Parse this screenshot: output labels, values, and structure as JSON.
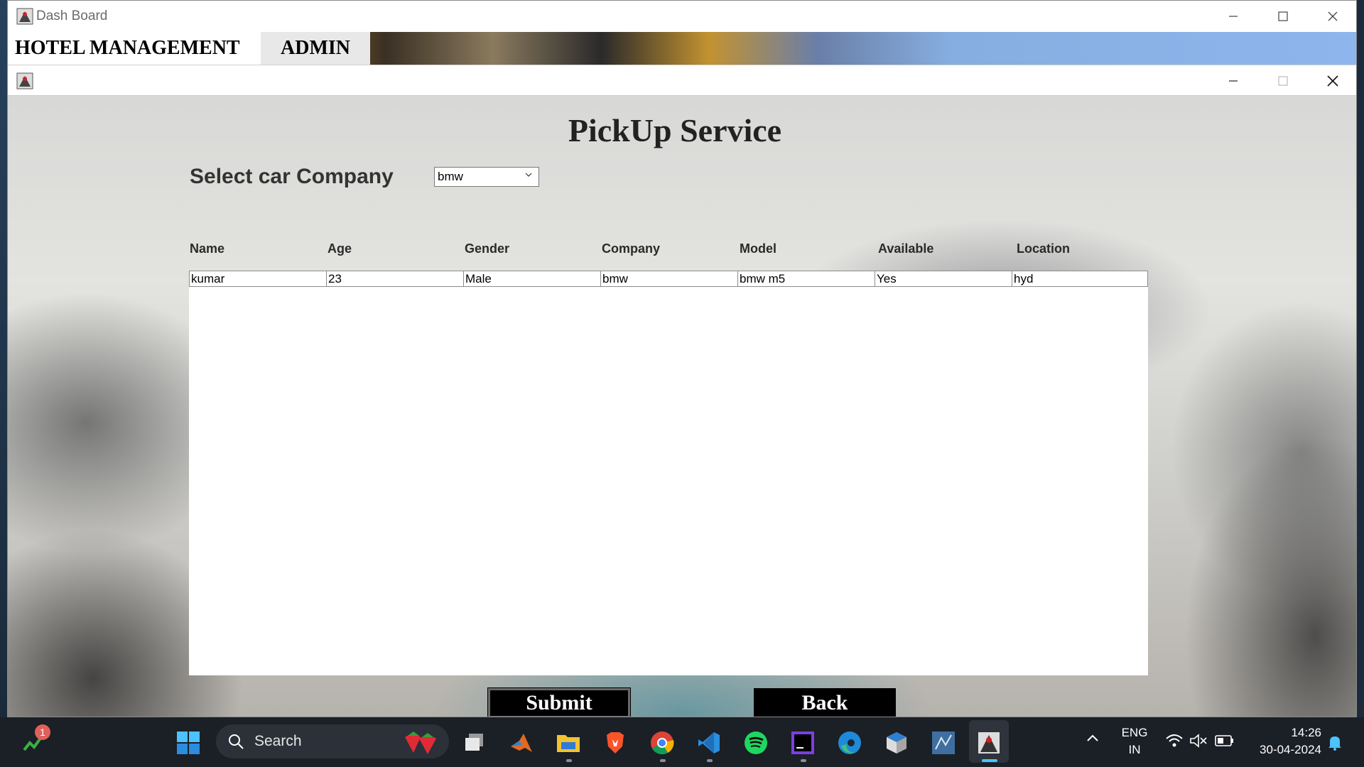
{
  "outer_window": {
    "title": "Dash Board",
    "menu": [
      "HOTEL MANAGEMENT",
      "ADMIN"
    ]
  },
  "page": {
    "title": "PickUp Service",
    "select_label": "Select car Company",
    "selected_company": "bmw"
  },
  "table": {
    "columns": [
      "Name",
      "Age",
      "Gender",
      "Company",
      "Model",
      "Available",
      "Location"
    ],
    "rows": [
      [
        "kumar",
        "23",
        "Male",
        "bmw",
        "bmw m5",
        "Yes",
        "hyd"
      ]
    ]
  },
  "buttons": {
    "submit": "Submit",
    "back": "Back"
  },
  "taskbar": {
    "search_label": "Search",
    "notification_badge": "1",
    "language": "ENG",
    "region": "IN",
    "time": "14:26",
    "date": "30-04-2024",
    "apps": [
      "widgets-icon",
      "windows-start-icon",
      "task-view-icon",
      "matlab-icon",
      "file-explorer-icon",
      "brave-icon",
      "chrome-icon",
      "vscode-icon",
      "spotify-icon",
      "intellij-icon",
      "edge-icon",
      "virtualbox-icon",
      "mysql-workbench-icon",
      "java-app-icon"
    ]
  }
}
